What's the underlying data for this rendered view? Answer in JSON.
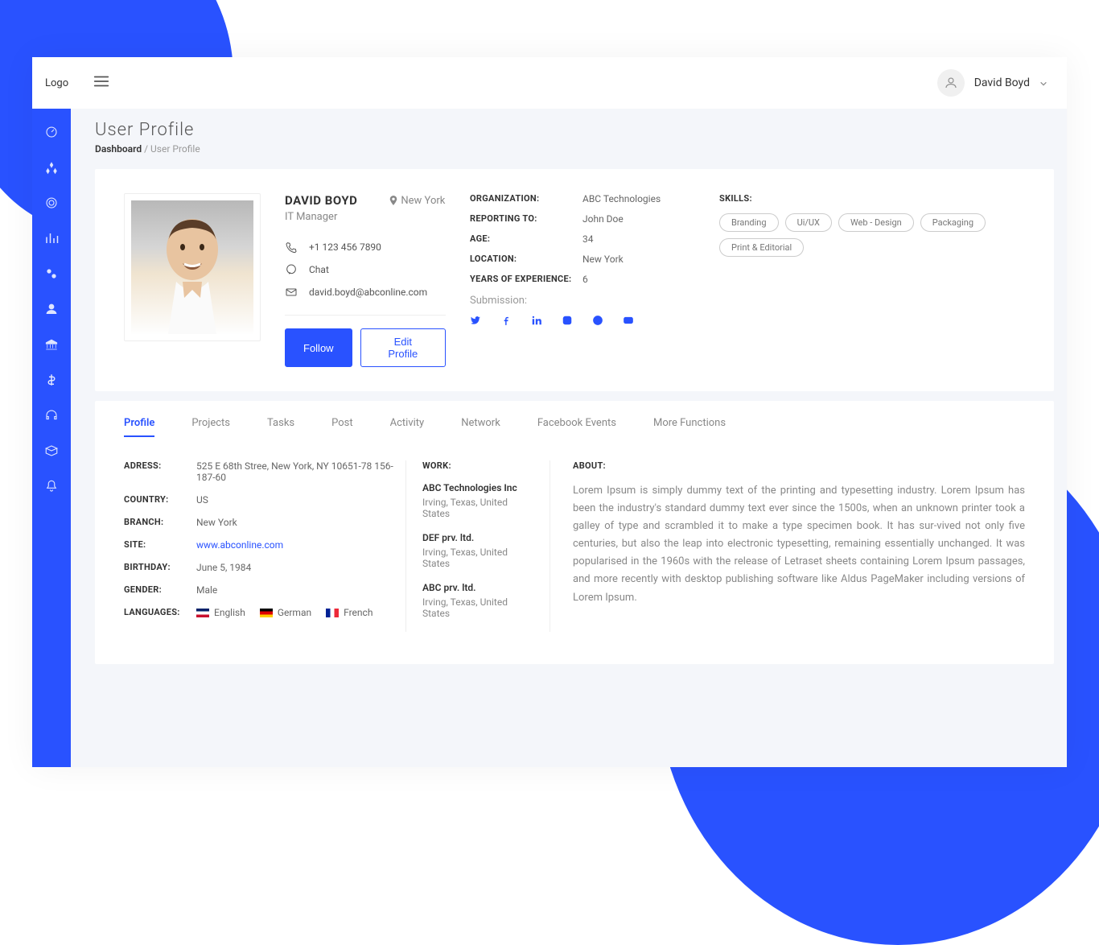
{
  "header": {
    "logo": "Logo",
    "userName": "David Boyd"
  },
  "page": {
    "title": "User Profile",
    "breadcrumbRoot": "Dashboard",
    "breadcrumbCurrent": "User Profile"
  },
  "profile": {
    "name": "DAVID BOYD",
    "location": "New York",
    "role": "IT Manager",
    "phone": "+1 123 456 7890",
    "chat": "Chat",
    "email": "david.boyd@abconline.com",
    "followBtn": "Follow",
    "editBtn": "Edit Profile",
    "details": {
      "orgLabel": "ORGANIZATION:",
      "org": "ABC Technologies",
      "reportingLabel": "REPORTING TO:",
      "reporting": "John Doe",
      "ageLabel": "AGE:",
      "age": "34",
      "locationLabel": "LOCATION:",
      "location": "New York",
      "expLabel": "YEARS OF EXPERIENCE:",
      "exp": "6"
    },
    "submissionLabel": "Submission:",
    "skillsLabel": "SKILLS:",
    "skills": [
      "Branding",
      "Ui/UX",
      "Web - Design",
      "Packaging",
      "Print & Editorial"
    ]
  },
  "tabs": [
    "Profile",
    "Projects",
    "Tasks",
    "Post",
    "Activity",
    "Network",
    "Facebook Events",
    "More Functions"
  ],
  "personal": {
    "addressLabel": "ADRESS:",
    "address": "525 E 68th Stree, New York, NY 10651-78 156-187-60",
    "countryLabel": "COUNTRY:",
    "country": "US",
    "branchLabel": "BRANCH:",
    "branch": "New York",
    "siteLabel": "SITE:",
    "site": "www.abconline.com",
    "birthdayLabel": "BIRTHDAY:",
    "birthday": "June 5, 1984",
    "genderLabel": "GENDER:",
    "gender": "Male",
    "languagesLabel": "LANGUAGES:",
    "languages": [
      "English",
      "German",
      "French"
    ]
  },
  "work": {
    "label": "WORK:",
    "items": [
      {
        "name": "ABC Technologies Inc",
        "loc": "Irving, Texas, United States"
      },
      {
        "name": "DEF prv. ltd.",
        "loc": "Irving, Texas, United States"
      },
      {
        "name": "ABC prv. ltd.",
        "loc": "Irving, Texas, United States"
      }
    ]
  },
  "about": {
    "label": "ABOUT:",
    "text": "Lorem Ipsum is simply dummy text of the printing and typesetting industry. Lorem Ipsum has been the industry's standard dummy text ever since the 1500s, when an unknown printer took a galley of type and scrambled it to make a type specimen book. It has sur-vived not only five centuries, but also the leap into electronic typesetting, remaining essentially unchanged. It was popularised in the 1960s with the release of Letraset sheets containing Lorem Ipsum passages, and more recently with desktop publishing software like Aldus PageMaker including versions of Lorem Ipsum."
  }
}
